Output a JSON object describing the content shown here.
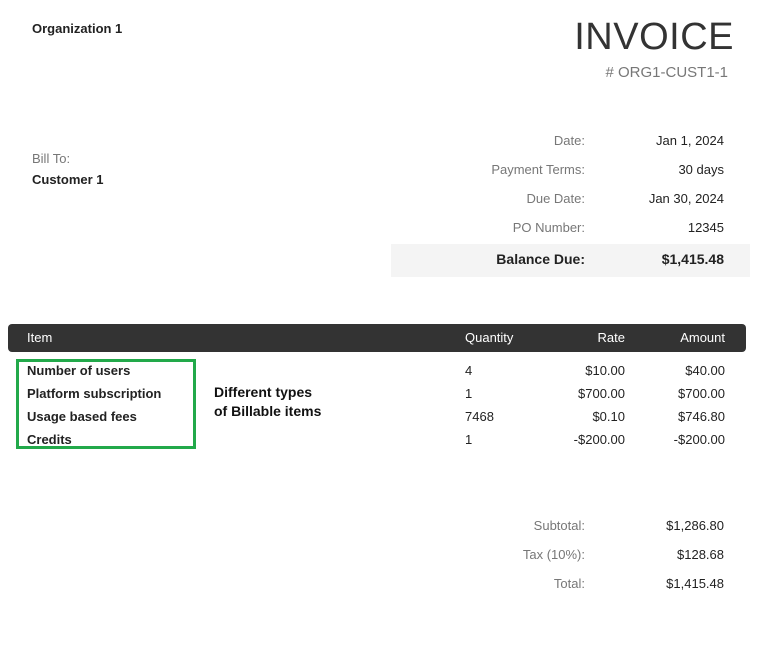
{
  "header": {
    "organization": "Organization 1",
    "title": "INVOICE",
    "invoice_number": "# ORG1-CUST1-1"
  },
  "bill_to": {
    "label": "Bill To:",
    "name": "Customer 1"
  },
  "meta": [
    {
      "label": "Date:",
      "value": "Jan 1, 2024"
    },
    {
      "label": "Payment Terms:",
      "value": "30 days"
    },
    {
      "label": "Due Date:",
      "value": "Jan 30, 2024"
    },
    {
      "label": "PO Number:",
      "value": "12345"
    }
  ],
  "balance": {
    "label": "Balance Due:",
    "value": "$1,415.48"
  },
  "table": {
    "headers": {
      "item": "Item",
      "quantity": "Quantity",
      "rate": "Rate",
      "amount": "Amount"
    },
    "rows": [
      {
        "item": "Number of users",
        "quantity": "4",
        "rate": "$10.00",
        "amount": "$40.00"
      },
      {
        "item": "Platform subscription",
        "quantity": "1",
        "rate": "$700.00",
        "amount": "$700.00"
      },
      {
        "item": "Usage based fees",
        "quantity": "7468",
        "rate": "$0.10",
        "amount": "$746.80"
      },
      {
        "item": "Credits",
        "quantity": "1",
        "rate": "-$200.00",
        "amount": "-$200.00"
      }
    ]
  },
  "annotation": {
    "line1": "Different types",
    "line2": "of Billable items",
    "box_color": "#22a94a"
  },
  "totals": [
    {
      "label": "Subtotal:",
      "value": "$1,286.80"
    },
    {
      "label": "Tax (10%):",
      "value": "$128.68"
    },
    {
      "label": "Total:",
      "value": "$1,415.48"
    }
  ]
}
